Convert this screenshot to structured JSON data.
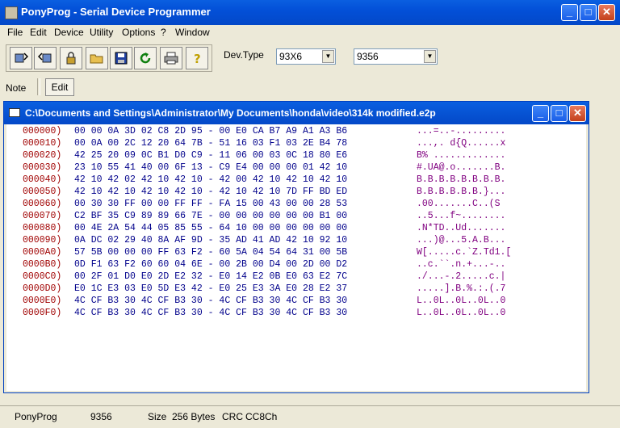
{
  "window": {
    "title": "PonyProg - Serial Device Programmer"
  },
  "menu": [
    "File",
    "Edit",
    "Device",
    "Utility",
    "Options",
    "?",
    "Window"
  ],
  "toolbar": {
    "devtype_label": "Dev.Type",
    "family": "93X6",
    "device": "9356"
  },
  "note": {
    "label": "Note",
    "edit_label": "Edit"
  },
  "child": {
    "title": "C:\\Documents and Settings\\Administrator\\My Documents\\honda\\video\\314k modified.e2p"
  },
  "hex_lines": [
    {
      "addr": "000000)",
      "hex": "00 00 0A 3D 02 C8 2D 95 - 00 E0 CA B7 A9 A1 A3 B6",
      "ascii": "...=..-........."
    },
    {
      "addr": "000010)",
      "hex": "00 0A 00 2C 12 20 64 7B - 51 16 03 F1 03 2E B4 78",
      "ascii": "...,. d{Q......x"
    },
    {
      "addr": "000020)",
      "hex": "42 25 20 09 0C B1 D0 C9 - 11 06 00 03 0C 18 80 E6",
      "ascii": "B% ............."
    },
    {
      "addr": "000030)",
      "hex": "23 10 55 41 40 00 6F 13 - C9 E4 00 00 00 01 42 10",
      "ascii": "#.UA@.o.......B."
    },
    {
      "addr": "000040)",
      "hex": "42 10 42 02 42 10 42 10 - 42 00 42 10 42 10 42 10",
      "ascii": "B.B.B.B.B.B.B.B."
    },
    {
      "addr": "000050)",
      "hex": "42 10 42 10 42 10 42 10 - 42 10 42 10 7D FF BD ED",
      "ascii": "B.B.B.B.B.B.}..."
    },
    {
      "addr": "000060)",
      "hex": "00 30 30 FF 00 00 FF FF - FA 15 00 43 00 00 28 53",
      "ascii": ".00.......C..(S"
    },
    {
      "addr": "000070)",
      "hex": "C2 BF 35 C9 89 89 66 7E - 00 00 00 00 00 00 B1 00",
      "ascii": "..5...f~........"
    },
    {
      "addr": "000080)",
      "hex": "00 4E 2A 54 44 05 85 55 - 64 10 00 00 00 00 00 00",
      "ascii": ".N*TD..Ud......."
    },
    {
      "addr": "000090)",
      "hex": "0A DC 02 29 40 8A AF 9D - 35 AD 41 AD 42 10 92 10",
      "ascii": "...)@...5.A.B..."
    },
    {
      "addr": "0000A0)",
      "hex": "57 5B 00 00 00 FF 63 F2 - 60 5A 04 54 64 31 00 5B",
      "ascii": "W[.....c.`Z.Td1.["
    },
    {
      "addr": "0000B0)",
      "hex": "0D F1 63 F2 60 60 04 6E - 00 2B 00 D4 00 2D 00 D2",
      "ascii": "..c.``.n.+...-.."
    },
    {
      "addr": "0000C0)",
      "hex": "00 2F 01 D0 E0 2D E2 32 - E0 14 E2 0B E0 63 E2 7C",
      "ascii": "./...-.2.....c.|"
    },
    {
      "addr": "0000D0)",
      "hex": "E0 1C E3 03 E0 5D E3 42 - E0 25 E3 3A E0 28 E2 37",
      "ascii": ".....].B.%.:.(.7"
    },
    {
      "addr": "0000E0)",
      "hex": "4C CF B3 30 4C CF B3 30 - 4C CF B3 30 4C CF B3 30",
      "ascii": "L..0L..0L..0L..0"
    },
    {
      "addr": "0000F0)",
      "hex": "4C CF B3 30 4C CF B3 30 - 4C CF B3 30 4C CF B3 30",
      "ascii": "L..0L..0L..0L..0"
    }
  ],
  "status": {
    "app": "PonyProg",
    "device": "9356",
    "size_label": "Size",
    "size_value": "256 Bytes",
    "crc_label": "CRC",
    "crc_value": "CC8Ch"
  }
}
